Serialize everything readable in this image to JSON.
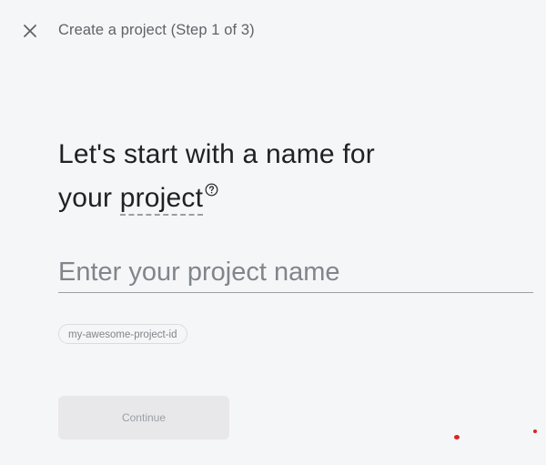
{
  "header": {
    "close_icon": "close-icon",
    "step_title": "Create a project (Step 1 of 3)"
  },
  "main": {
    "heading_line1": "Let's start with a name for",
    "heading_prefix": "your",
    "heading_term": "project",
    "help_icon": "help-circle-icon",
    "name_input": {
      "value": "",
      "placeholder": "Enter your project name"
    },
    "project_id_chip": "my-awesome-project-id",
    "continue_label": "Continue"
  },
  "colors": {
    "background": "#f5f6f8",
    "text_primary": "#202124",
    "text_secondary": "#5f6368",
    "button_disabled_bg": "#e8e8ea",
    "button_disabled_text": "#9aa0a6"
  }
}
